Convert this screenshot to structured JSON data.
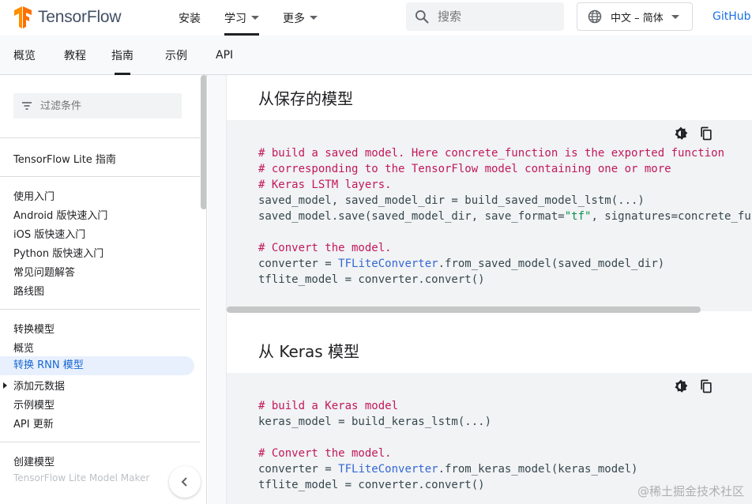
{
  "brand": {
    "name": "TensorFlow"
  },
  "topnav": {
    "items": [
      {
        "label": "安装"
      },
      {
        "label": "学习"
      },
      {
        "label": "更多"
      }
    ],
    "search_placeholder": "搜索",
    "language": "中文 – 简体",
    "github": "GitHub"
  },
  "subnav": {
    "tabs": [
      {
        "label": "概览"
      },
      {
        "label": "教程"
      },
      {
        "label": "指南"
      },
      {
        "label": "示例"
      },
      {
        "label": "API"
      }
    ]
  },
  "sidebar": {
    "filter_placeholder": "过滤条件",
    "section_top": "TensorFlow Lite 指南",
    "group1": [
      "使用入门",
      "Android 版快速入门",
      "iOS 版快速入门",
      "Python 版快速入门",
      "常见问题解答",
      "路线图"
    ],
    "group2": [
      "转换模型",
      "概览",
      "转换 RNN 模型",
      "添加元数据",
      "示例模型",
      "API 更新"
    ],
    "group3": [
      "创建模型"
    ],
    "faded": "TensorFlow Lite Model Maker"
  },
  "content": {
    "section1_title": "从保存的模型",
    "section2_title": "从 Keras 模型",
    "code1": {
      "c1": "# build a saved model. Here concrete_function is the exported function",
      "c2": "# corresponding to the TensorFlow model containing one or more",
      "c3": "# Keras LSTM layers.",
      "l4": "saved_model, saved_model_dir = build_saved_model_lstm(...)",
      "l5a": "saved_model.save(saved_model_dir, save_format=",
      "l5s": "\"tf\"",
      "l5b": ", signatures=concrete_fu",
      "c7": "# Convert the model.",
      "l8a": "converter = ",
      "l8c": "TFLiteConverter",
      "l8b": ".from_saved_model(saved_model_dir)",
      "l9": "tflite_model = converter.convert()"
    },
    "code2": {
      "c1": "# build a Keras model",
      "l2": "keras_model = build_keras_lstm(...)",
      "c4": "# Convert the model.",
      "l5a": "converter = ",
      "l5c": "TFLiteConverter",
      "l5b": ".from_keras_model(keras_model)",
      "l6": "tflite_model = converter.convert()"
    }
  },
  "watermark": "@稀土掘金技术社区",
  "colors": {
    "accent": "#1a73e8",
    "comment": "#c2185b",
    "class": "#3367d6",
    "string": "#0d904f",
    "logo_orange": "#ff6f00"
  }
}
